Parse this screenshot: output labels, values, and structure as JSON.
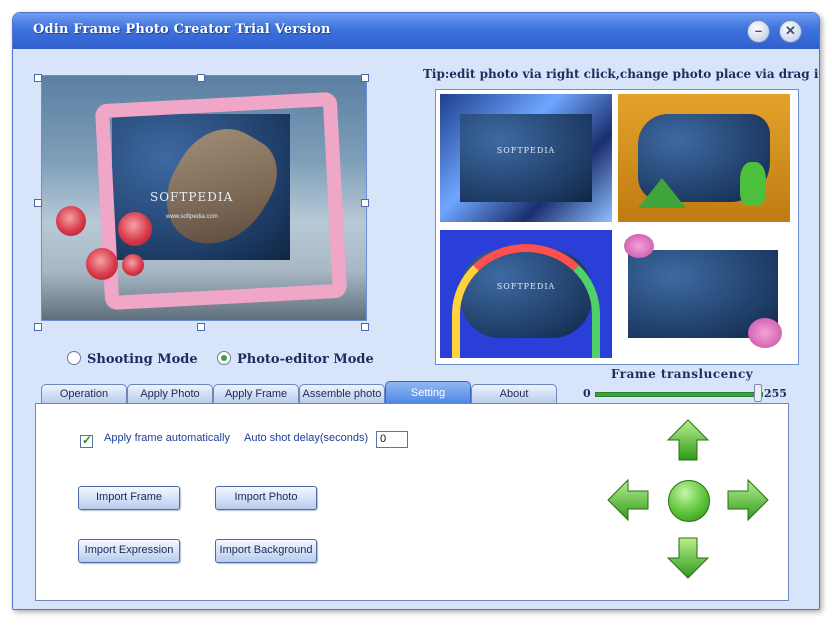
{
  "window": {
    "title": "Odin Frame Photo Creator Trial Version",
    "minimize_symbol": "–",
    "close_symbol": "✕"
  },
  "editor": {
    "watermark_main": "SOFTPEDIA",
    "watermark_sub": "www.softpedia.com"
  },
  "thumbs": {
    "tip": "Tip:edit photo via right click,change photo place via drag it",
    "items": [
      {
        "label": "SOFTPEDIA"
      },
      {
        "label": ""
      },
      {
        "label": "SOFTPEDIA"
      },
      {
        "label": ""
      }
    ]
  },
  "modes": {
    "shooting_label": "Shooting Mode",
    "photo_editor_label": "Photo-editor Mode",
    "selected": "Photo-editor Mode"
  },
  "translucency": {
    "label": "Frame translucency",
    "min": "0",
    "max": "255",
    "value": 255
  },
  "tabs": [
    {
      "label": "Operation"
    },
    {
      "label": "Apply Photo"
    },
    {
      "label": "Apply Frame"
    },
    {
      "label": "Assemble photo"
    },
    {
      "label": "Setting"
    },
    {
      "label": "About"
    }
  ],
  "active_tab": "Setting",
  "settings": {
    "apply_frame_label": "Apply frame automatically",
    "apply_frame_checked": true,
    "delay_label": "Auto shot delay(seconds)",
    "delay_value": "0",
    "import_frame": "Import Frame",
    "import_photo": "Import Photo",
    "import_expression": "Import Expression",
    "import_background": "Import Background"
  },
  "icons": {
    "up": "arrow-up-icon",
    "down": "arrow-down-icon",
    "left": "arrow-left-icon",
    "right": "arrow-right-icon",
    "center": "center-ball-icon"
  },
  "colors": {
    "accent_green": "#3aa23a",
    "title_blue": "#3e72dd",
    "frame_pink": "#f0a6c6"
  }
}
